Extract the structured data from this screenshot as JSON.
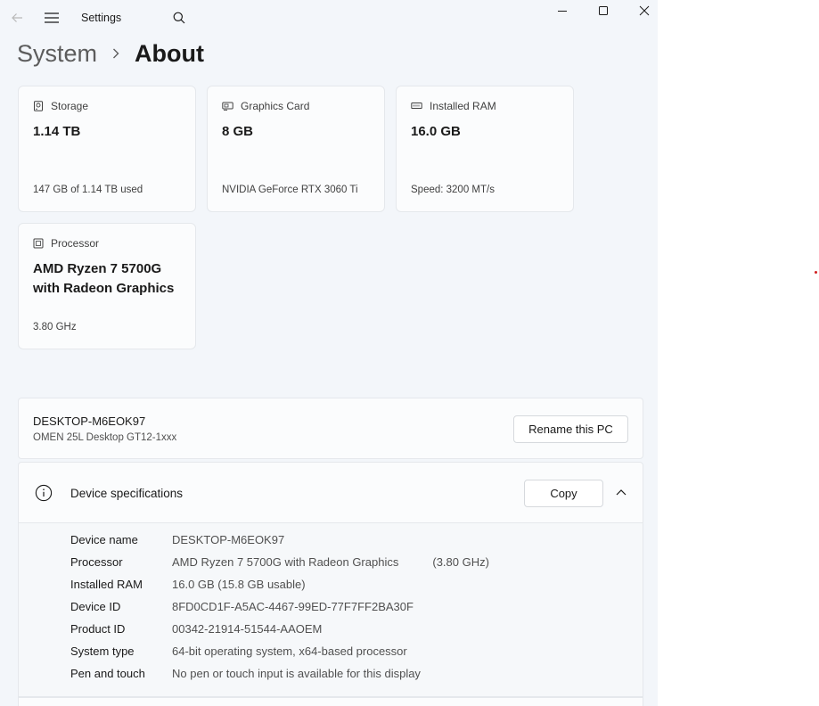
{
  "window": {
    "app_title": "Settings"
  },
  "breadcrumb": {
    "parent": "System",
    "current": "About"
  },
  "cards": {
    "storage": {
      "label": "Storage",
      "value": "1.14 TB",
      "sub": "147 GB of 1.14 TB used",
      "icon": "storage-icon"
    },
    "graphics": {
      "label": "Graphics Card",
      "value": "8 GB",
      "sub": "NVIDIA GeForce RTX 3060 Ti",
      "icon": "graphics-card-icon"
    },
    "ram": {
      "label": "Installed RAM",
      "value": "16.0 GB",
      "sub": "Speed: 3200 MT/s",
      "icon": "ram-icon"
    },
    "processor": {
      "label": "Processor",
      "value_line1": "AMD Ryzen 7 5700G",
      "value_line2": "with Radeon Graphics",
      "sub": "3.80 GHz",
      "icon": "processor-icon"
    }
  },
  "pc": {
    "name": "DESKTOP-M6EOK97",
    "model": "OMEN 25L Desktop GT12-1xxx",
    "rename_label": "Rename this PC"
  },
  "device_specs": {
    "title": "Device specifications",
    "copy_label": "Copy",
    "rows": [
      {
        "label": "Device name",
        "value": "DESKTOP-M6EOK97"
      },
      {
        "label": "Processor",
        "value": "AMD Ryzen 7 5700G with Radeon Graphics",
        "extra": "(3.80 GHz)"
      },
      {
        "label": "Installed RAM",
        "value": "16.0 GB (15.8 GB usable)"
      },
      {
        "label": "Device ID",
        "value": "8FD0CD1F-A5AC-4467-99ED-77F7FF2BA30F"
      },
      {
        "label": "Product ID",
        "value": "00342-21914-51544-AAOEM"
      },
      {
        "label": "System type",
        "value": "64-bit operating system, x64-based processor"
      },
      {
        "label": "Pen and touch",
        "value": "No pen or touch input is available for this display"
      }
    ]
  },
  "colors": {
    "window_bg": "#f3f6fa",
    "card_bg": "#fbfcfd",
    "text": "#1a1a1a"
  }
}
